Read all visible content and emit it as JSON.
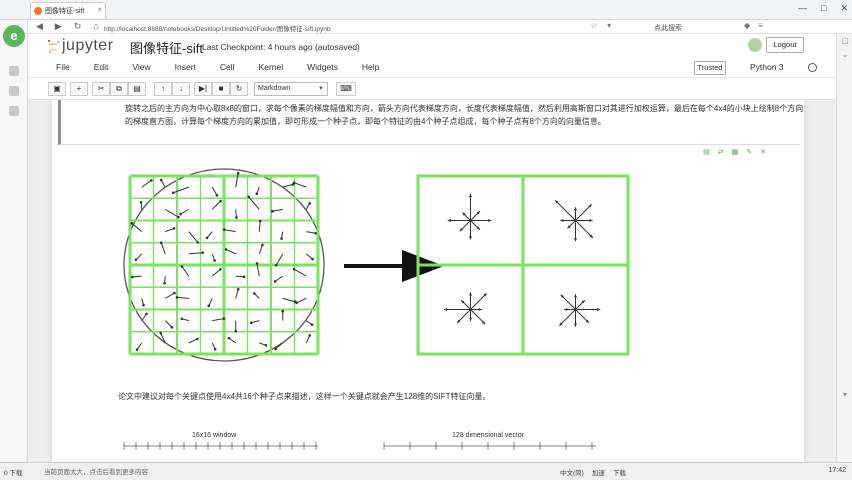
{
  "browser": {
    "tab_title": "图像特征-sift",
    "url": "http://localhost:8888/notebooks/Desktop/Untitled%20Folder/图像特征-sift.ipynb",
    "search_placeholder": "点此搜索",
    "window_controls": [
      "—",
      "□",
      "✕"
    ]
  },
  "header": {
    "logo_text": "jupyter",
    "notebook_title": "图像特征-sift",
    "checkpoint_label": "Last Checkpoint:",
    "checkpoint_time": "4 hours ago",
    "checkpoint_status": "(autosaved)",
    "logout_label": "Logout"
  },
  "menu": {
    "items": [
      "File",
      "Edit",
      "View",
      "Insert",
      "Cell",
      "Kernel",
      "Widgets",
      "Help"
    ],
    "trusted_label": "Trusted",
    "kernel_label": "Python 3"
  },
  "toolbar": {
    "buttons": [
      "save",
      "add",
      "cut",
      "copy",
      "paste",
      "move-up",
      "move-down",
      "run",
      "stop",
      "restart"
    ],
    "cell_type": "Markdown"
  },
  "cell": {
    "text": "旋转之后的主方向为中心取8x8的窗口，求每个像素的梯度幅值和方向，箭头方向代表梯度方向，长度代表梯度幅值，然后利用高斯窗口对其进行加权运算，最后在每个4x4的小块上绘制8个方向的梯度直方图，计算每个梯度方向的累加值，即可形成一个种子点，即每个特征的由4个种子点组成，每个种子点有8个方向的向量信息。",
    "paragraph2": "论文中建议对每个关键点使用4x4共16个种子点来描述，这样一个关键点就会产生128维的SIFT特征向量。",
    "diagram_label_left": "16x16 window",
    "diagram_label_right": "128 dimensional vector"
  },
  "statusbar": {
    "left_text": "0 下载",
    "message": "当前页面太大，点击后看到更多内容",
    "right_items": [
      "中文(简)",
      "加速",
      "下载"
    ],
    "clock": "17:42"
  }
}
